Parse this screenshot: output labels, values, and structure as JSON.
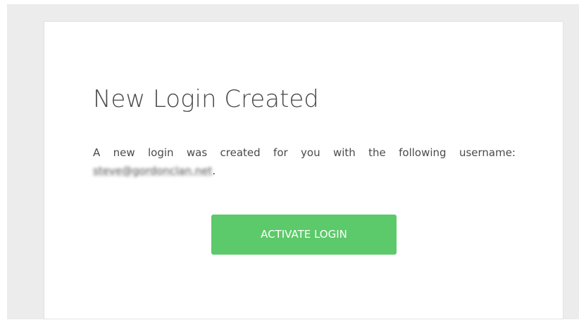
{
  "card": {
    "title": "New Login Created",
    "message_text": "A new login was created for you with the following username:",
    "username": "steve@gordonclan.net",
    "punctuation": ".",
    "button_label": "ACTIVATE LOGIN"
  },
  "colors": {
    "page_background": "#ececec",
    "card_background": "#ffffff",
    "text": "#4a4a4a",
    "button": "#5cc96a",
    "button_text": "#ffffff"
  }
}
